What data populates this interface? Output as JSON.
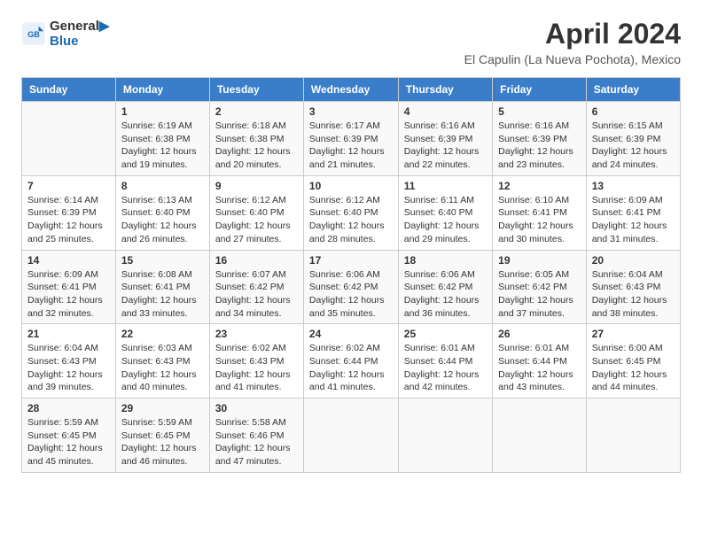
{
  "header": {
    "logo_line1": "General",
    "logo_line2": "Blue",
    "title": "April 2024",
    "subtitle": "El Capulin (La Nueva Pochota), Mexico"
  },
  "calendar": {
    "days_of_week": [
      "Sunday",
      "Monday",
      "Tuesday",
      "Wednesday",
      "Thursday",
      "Friday",
      "Saturday"
    ],
    "weeks": [
      [
        {
          "day": "",
          "info": ""
        },
        {
          "day": "1",
          "info": "Sunrise: 6:19 AM\nSunset: 6:38 PM\nDaylight: 12 hours\nand 19 minutes."
        },
        {
          "day": "2",
          "info": "Sunrise: 6:18 AM\nSunset: 6:38 PM\nDaylight: 12 hours\nand 20 minutes."
        },
        {
          "day": "3",
          "info": "Sunrise: 6:17 AM\nSunset: 6:39 PM\nDaylight: 12 hours\nand 21 minutes."
        },
        {
          "day": "4",
          "info": "Sunrise: 6:16 AM\nSunset: 6:39 PM\nDaylight: 12 hours\nand 22 minutes."
        },
        {
          "day": "5",
          "info": "Sunrise: 6:16 AM\nSunset: 6:39 PM\nDaylight: 12 hours\nand 23 minutes."
        },
        {
          "day": "6",
          "info": "Sunrise: 6:15 AM\nSunset: 6:39 PM\nDaylight: 12 hours\nand 24 minutes."
        }
      ],
      [
        {
          "day": "7",
          "info": "Sunrise: 6:14 AM\nSunset: 6:39 PM\nDaylight: 12 hours\nand 25 minutes."
        },
        {
          "day": "8",
          "info": "Sunrise: 6:13 AM\nSunset: 6:40 PM\nDaylight: 12 hours\nand 26 minutes."
        },
        {
          "day": "9",
          "info": "Sunrise: 6:12 AM\nSunset: 6:40 PM\nDaylight: 12 hours\nand 27 minutes."
        },
        {
          "day": "10",
          "info": "Sunrise: 6:12 AM\nSunset: 6:40 PM\nDaylight: 12 hours\nand 28 minutes."
        },
        {
          "day": "11",
          "info": "Sunrise: 6:11 AM\nSunset: 6:40 PM\nDaylight: 12 hours\nand 29 minutes."
        },
        {
          "day": "12",
          "info": "Sunrise: 6:10 AM\nSunset: 6:41 PM\nDaylight: 12 hours\nand 30 minutes."
        },
        {
          "day": "13",
          "info": "Sunrise: 6:09 AM\nSunset: 6:41 PM\nDaylight: 12 hours\nand 31 minutes."
        }
      ],
      [
        {
          "day": "14",
          "info": "Sunrise: 6:09 AM\nSunset: 6:41 PM\nDaylight: 12 hours\nand 32 minutes."
        },
        {
          "day": "15",
          "info": "Sunrise: 6:08 AM\nSunset: 6:41 PM\nDaylight: 12 hours\nand 33 minutes."
        },
        {
          "day": "16",
          "info": "Sunrise: 6:07 AM\nSunset: 6:42 PM\nDaylight: 12 hours\nand 34 minutes."
        },
        {
          "day": "17",
          "info": "Sunrise: 6:06 AM\nSunset: 6:42 PM\nDaylight: 12 hours\nand 35 minutes."
        },
        {
          "day": "18",
          "info": "Sunrise: 6:06 AM\nSunset: 6:42 PM\nDaylight: 12 hours\nand 36 minutes."
        },
        {
          "day": "19",
          "info": "Sunrise: 6:05 AM\nSunset: 6:42 PM\nDaylight: 12 hours\nand 37 minutes."
        },
        {
          "day": "20",
          "info": "Sunrise: 6:04 AM\nSunset: 6:43 PM\nDaylight: 12 hours\nand 38 minutes."
        }
      ],
      [
        {
          "day": "21",
          "info": "Sunrise: 6:04 AM\nSunset: 6:43 PM\nDaylight: 12 hours\nand 39 minutes."
        },
        {
          "day": "22",
          "info": "Sunrise: 6:03 AM\nSunset: 6:43 PM\nDaylight: 12 hours\nand 40 minutes."
        },
        {
          "day": "23",
          "info": "Sunrise: 6:02 AM\nSunset: 6:43 PM\nDaylight: 12 hours\nand 41 minutes."
        },
        {
          "day": "24",
          "info": "Sunrise: 6:02 AM\nSunset: 6:44 PM\nDaylight: 12 hours\nand 41 minutes."
        },
        {
          "day": "25",
          "info": "Sunrise: 6:01 AM\nSunset: 6:44 PM\nDaylight: 12 hours\nand 42 minutes."
        },
        {
          "day": "26",
          "info": "Sunrise: 6:01 AM\nSunset: 6:44 PM\nDaylight: 12 hours\nand 43 minutes."
        },
        {
          "day": "27",
          "info": "Sunrise: 6:00 AM\nSunset: 6:45 PM\nDaylight: 12 hours\nand 44 minutes."
        }
      ],
      [
        {
          "day": "28",
          "info": "Sunrise: 5:59 AM\nSunset: 6:45 PM\nDaylight: 12 hours\nand 45 minutes."
        },
        {
          "day": "29",
          "info": "Sunrise: 5:59 AM\nSunset: 6:45 PM\nDaylight: 12 hours\nand 46 minutes."
        },
        {
          "day": "30",
          "info": "Sunrise: 5:58 AM\nSunset: 6:46 PM\nDaylight: 12 hours\nand 47 minutes."
        },
        {
          "day": "",
          "info": ""
        },
        {
          "day": "",
          "info": ""
        },
        {
          "day": "",
          "info": ""
        },
        {
          "day": "",
          "info": ""
        }
      ]
    ]
  }
}
